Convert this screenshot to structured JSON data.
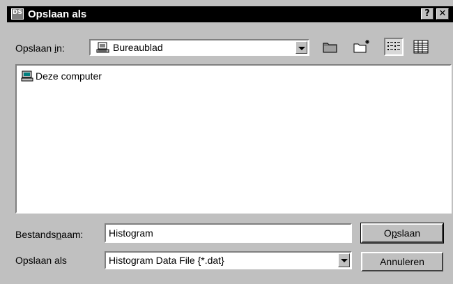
{
  "window": {
    "title": "Opslaan als",
    "app_icon_text": "DS",
    "help_button": "?",
    "close_button": "✕"
  },
  "save_in": {
    "label_before": "Opslaan ",
    "label_mnemonic": "i",
    "label_after": "n:",
    "value": "Bureaublad"
  },
  "toolbar": {
    "icons": [
      "up-folder-icon",
      "new-folder-icon",
      "list-view-icon",
      "details-view-icon"
    ]
  },
  "file_list": {
    "items": [
      {
        "label": "Deze computer",
        "icon": "computer-icon"
      }
    ]
  },
  "filename": {
    "label_before": "Bestands",
    "label_mnemonic": "n",
    "label_after": "aam:",
    "value": "Histogram"
  },
  "save_as_type": {
    "label": "Opslaan als",
    "value": "Histogram Data File {*.dat}"
  },
  "buttons": {
    "save_before": "O",
    "save_mnemonic": "p",
    "save_after": "slaan",
    "cancel": "Annuleren"
  }
}
